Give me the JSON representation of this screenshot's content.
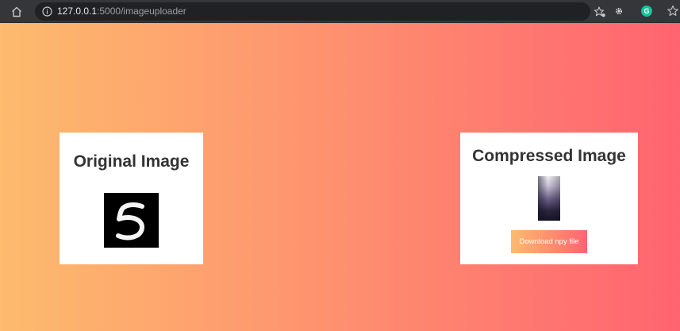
{
  "browser": {
    "url_host": "127.0.0.1",
    "url_path": ":5000/imageuploader",
    "icons": [
      "home-icon",
      "info-icon",
      "star-tag-icon",
      "extension-gear-icon",
      "grammarly-icon",
      "bookmarks-icon"
    ],
    "grammarly_letter": "G"
  },
  "page": {
    "background_gradient": [
      "#fdbb6e",
      "#ff6470"
    ],
    "original_card": {
      "title": "Original Image",
      "digit": "5"
    },
    "compressed_card": {
      "title": "Compressed Image",
      "download_label": "Download npy file",
      "button_gradient": [
        "#fdbb6e",
        "#ff6470"
      ]
    }
  },
  "colors": {
    "toolbar": "#35363a",
    "url_bar": "#202124",
    "card": "#ffffff",
    "title_text": "#333333"
  }
}
